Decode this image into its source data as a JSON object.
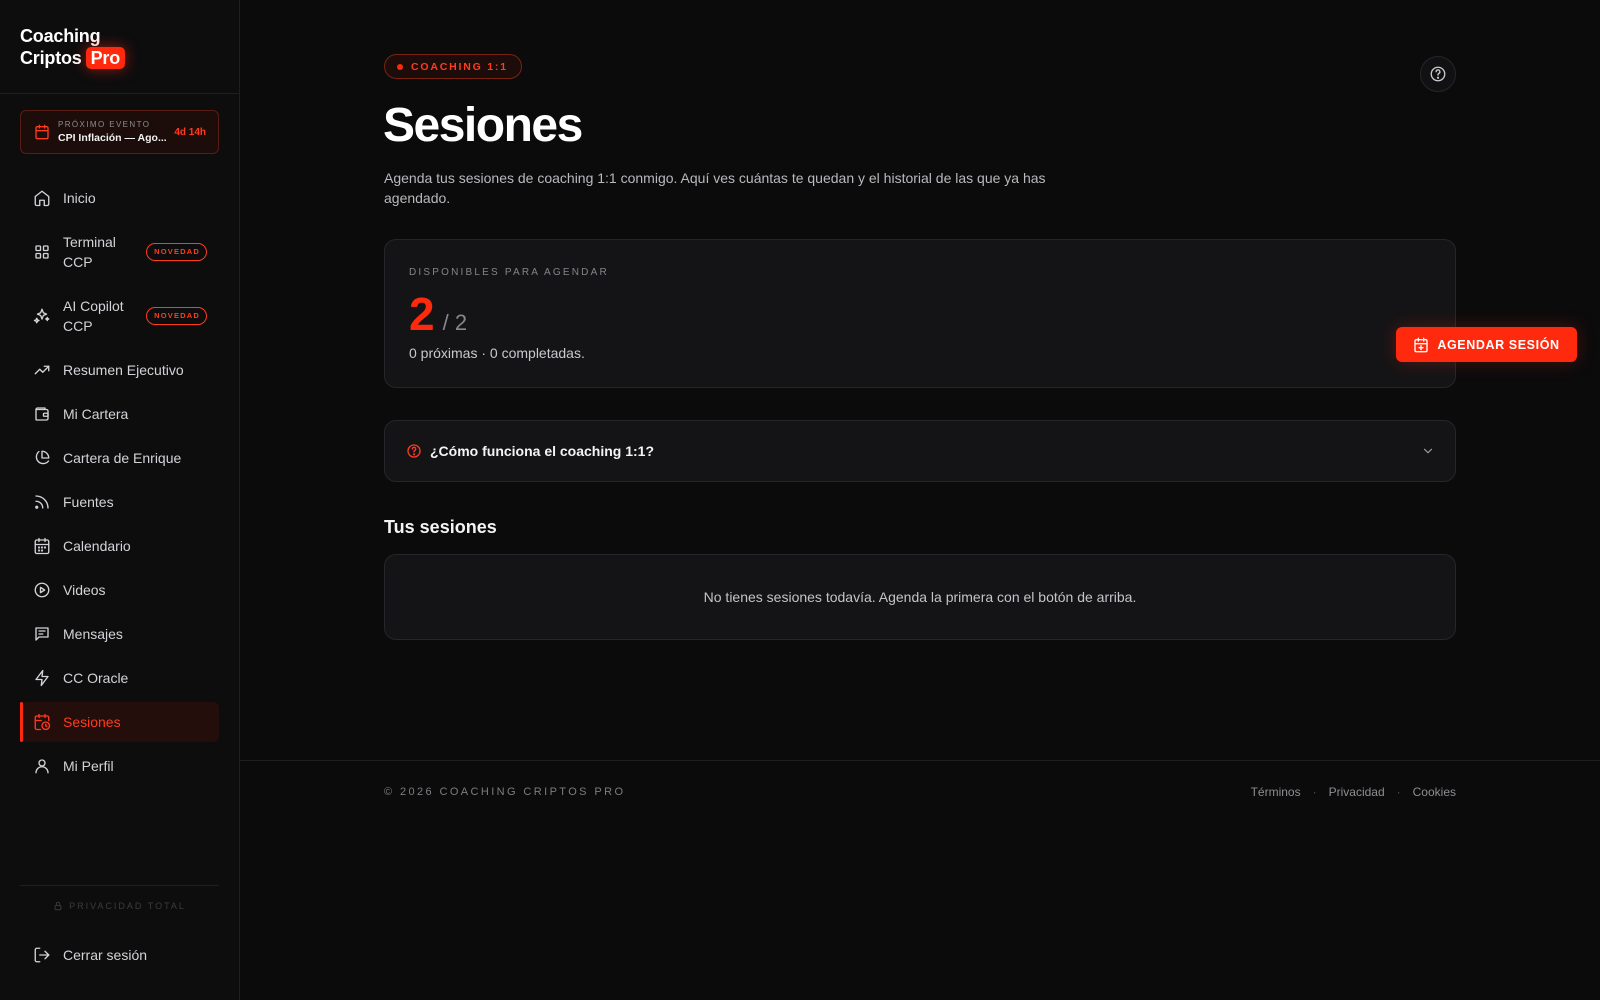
{
  "brand": {
    "line1": "Coaching",
    "line2": "Criptos",
    "badge": "Pro"
  },
  "event": {
    "label": "PRÓXIMO EVENTO",
    "name": "CPI Inflación — Ago...",
    "countdown": "4d 14h"
  },
  "nav": [
    {
      "label": "Inicio",
      "icon": "home-icon"
    },
    {
      "label": "Terminal CCP",
      "icon": "grid-icon",
      "badge": "NOVEDAD"
    },
    {
      "label": "AI Copilot CCP",
      "icon": "sparkles-icon",
      "badge": "NOVEDAD"
    },
    {
      "label": "Resumen Ejecutivo",
      "icon": "trending-up-icon"
    },
    {
      "label": "Mi Cartera",
      "icon": "wallet-icon"
    },
    {
      "label": "Cartera de Enrique",
      "icon": "pie-chart-icon"
    },
    {
      "label": "Fuentes",
      "icon": "rss-icon"
    },
    {
      "label": "Calendario",
      "icon": "calendar-icon"
    },
    {
      "label": "Videos",
      "icon": "play-circle-icon"
    },
    {
      "label": "Mensajes",
      "icon": "message-icon"
    },
    {
      "label": "CC Oracle",
      "icon": "zap-icon"
    },
    {
      "label": "Sesiones",
      "icon": "calendar-clock-icon",
      "active": true
    },
    {
      "label": "Mi Perfil",
      "icon": "user-icon"
    }
  ],
  "sidebar_footer": {
    "privacy": "PRIVACIDAD TOTAL",
    "logout": "Cerrar sesión"
  },
  "page": {
    "tag": "COACHING 1:1",
    "title": "Sesiones",
    "subtitle": "Agenda tus sesiones de coaching 1:1 conmigo. Aquí ves cuántas te quedan y el historial de las que ya has agendado."
  },
  "availability": {
    "label": "DISPONIBLES PARA AGENDAR",
    "available": "2",
    "total": "/ 2",
    "summary": "0 próximas · 0 completadas.",
    "cta": "AGENDAR SESIÓN"
  },
  "faq": {
    "title": "¿Cómo funciona el coaching 1:1?"
  },
  "sessions": {
    "title": "Tus sesiones",
    "empty": "No tienes sesiones todavía. Agenda la primera con el botón de arriba."
  },
  "footer": {
    "copyright": "© 2026 COACHING CRIPTOS PRO",
    "links": [
      "Términos",
      "Privacidad",
      "Cookies"
    ]
  },
  "colors": {
    "accent": "#ff2a0d",
    "background": "#0b0b0c",
    "card": "#141416"
  }
}
